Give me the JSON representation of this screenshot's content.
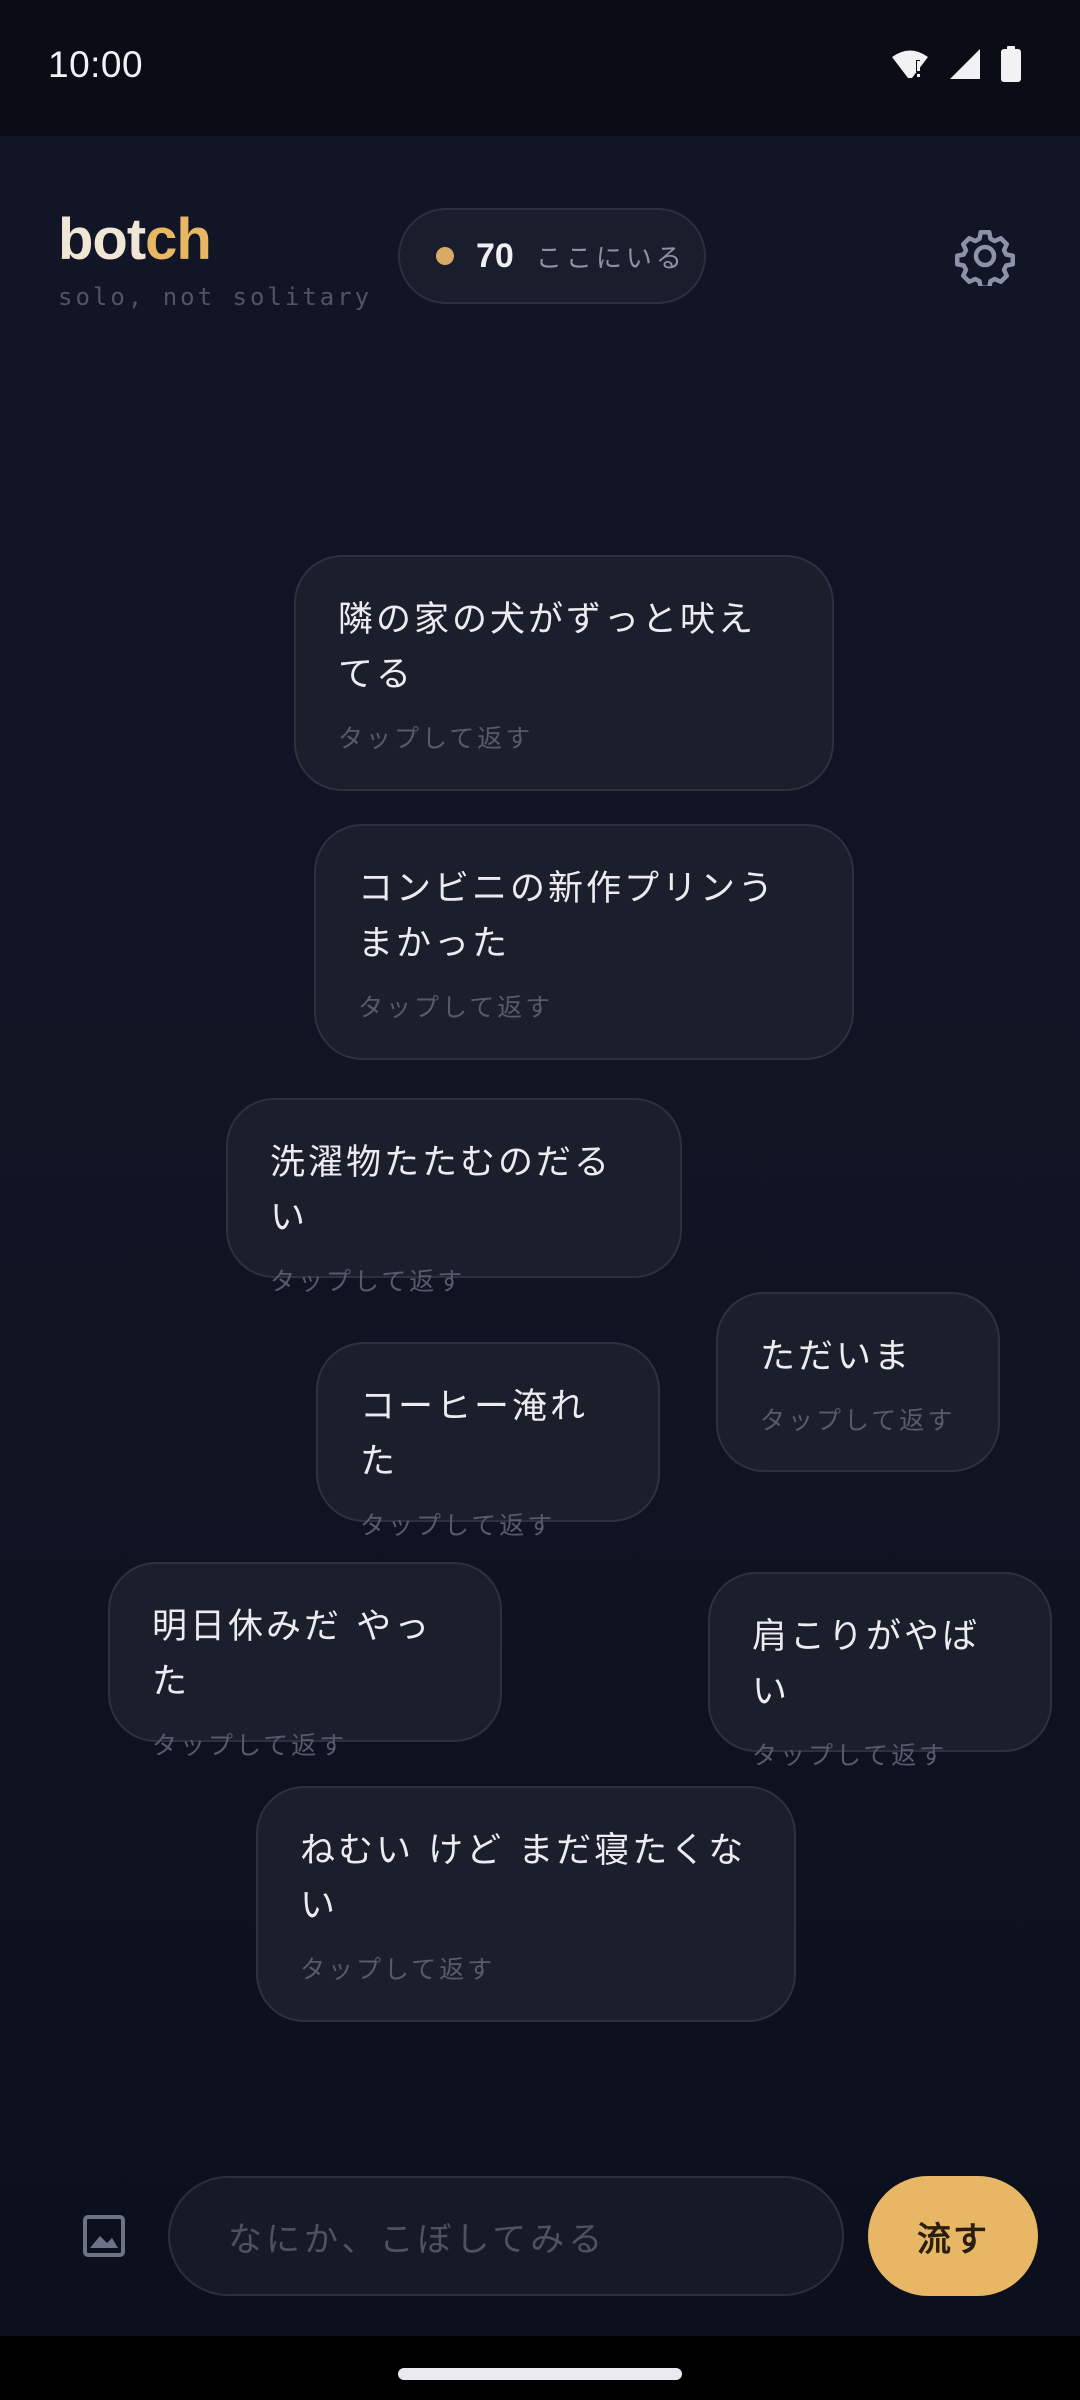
{
  "status_bar": {
    "time": "10:00",
    "icons": [
      "wifi-alert-icon",
      "signal-icon",
      "battery-icon"
    ]
  },
  "header": {
    "brand_part1": "bot",
    "brand_part2": "ch",
    "tagline": "solo, not solitary",
    "presence": {
      "count": "70",
      "label": "ここにいる"
    },
    "settings_icon": "gear-icon"
  },
  "bubbles": [
    {
      "text": "隣の家の犬がずっと吠えてる",
      "hint": "タップして返す"
    },
    {
      "text": "コンビニの新作プリンうまかった",
      "hint": "タップして返す"
    },
    {
      "text": "洗濯物たたむのだるい",
      "hint": "タップして返す"
    },
    {
      "text": "ただいま",
      "hint": "タップして返す"
    },
    {
      "text": "コーヒー淹れた",
      "hint": "タップして返す"
    },
    {
      "text": "明日休みだ やった",
      "hint": "タップして返す"
    },
    {
      "text": "肩こりがやばい",
      "hint": "タップして返す"
    },
    {
      "text": "ねむい けど まだ寝たくない",
      "hint": "タップして返す"
    }
  ],
  "composer": {
    "image_icon": "image-icon",
    "placeholder": "なにか、こぼしてみる",
    "send_label": "流す"
  },
  "colors": {
    "accent": "#e7b766",
    "background": "#0f1220",
    "bubble": "#1b1f2c"
  }
}
